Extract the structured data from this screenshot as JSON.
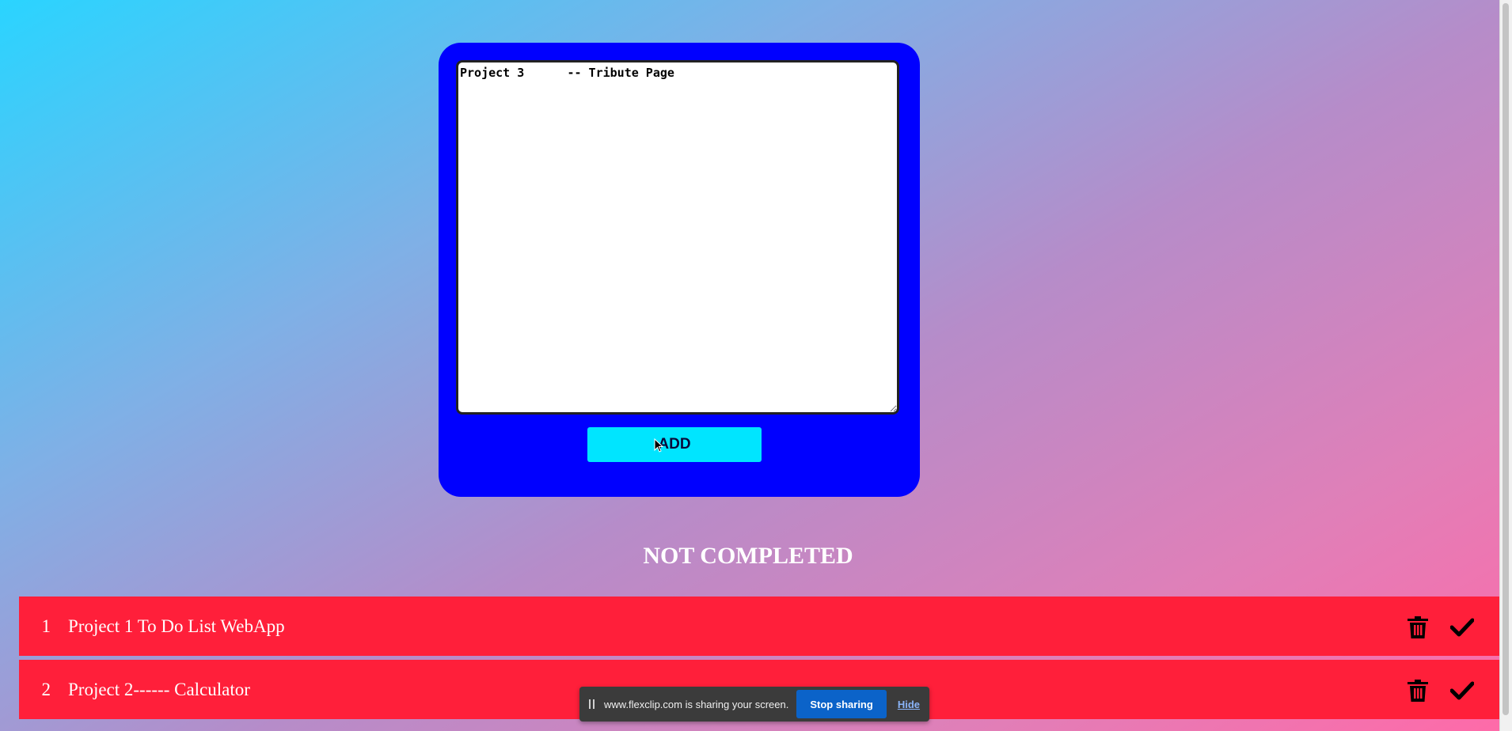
{
  "input": {
    "textarea_value": "Project 3      -- Tribute Page",
    "add_label": "ADD"
  },
  "section": {
    "title": "NOT COMPLETED"
  },
  "tasks": [
    {
      "index": "1",
      "text": "Project 1 To Do List WebApp",
      "delete_icon": "trash-icon",
      "complete_icon": "check-icon"
    },
    {
      "index": "2",
      "text": "Project 2------ Calculator",
      "delete_icon": "trash-icon",
      "complete_icon": "check-icon"
    }
  ],
  "share_bar": {
    "message": "www.flexclip.com is sharing your screen.",
    "stop_label": "Stop sharing",
    "hide_label": "Hide"
  },
  "colors": {
    "card": "#0000ff",
    "add_button": "#00e5ff",
    "task_row": "#ff1f3a",
    "stop_button": "#0b63c9"
  }
}
